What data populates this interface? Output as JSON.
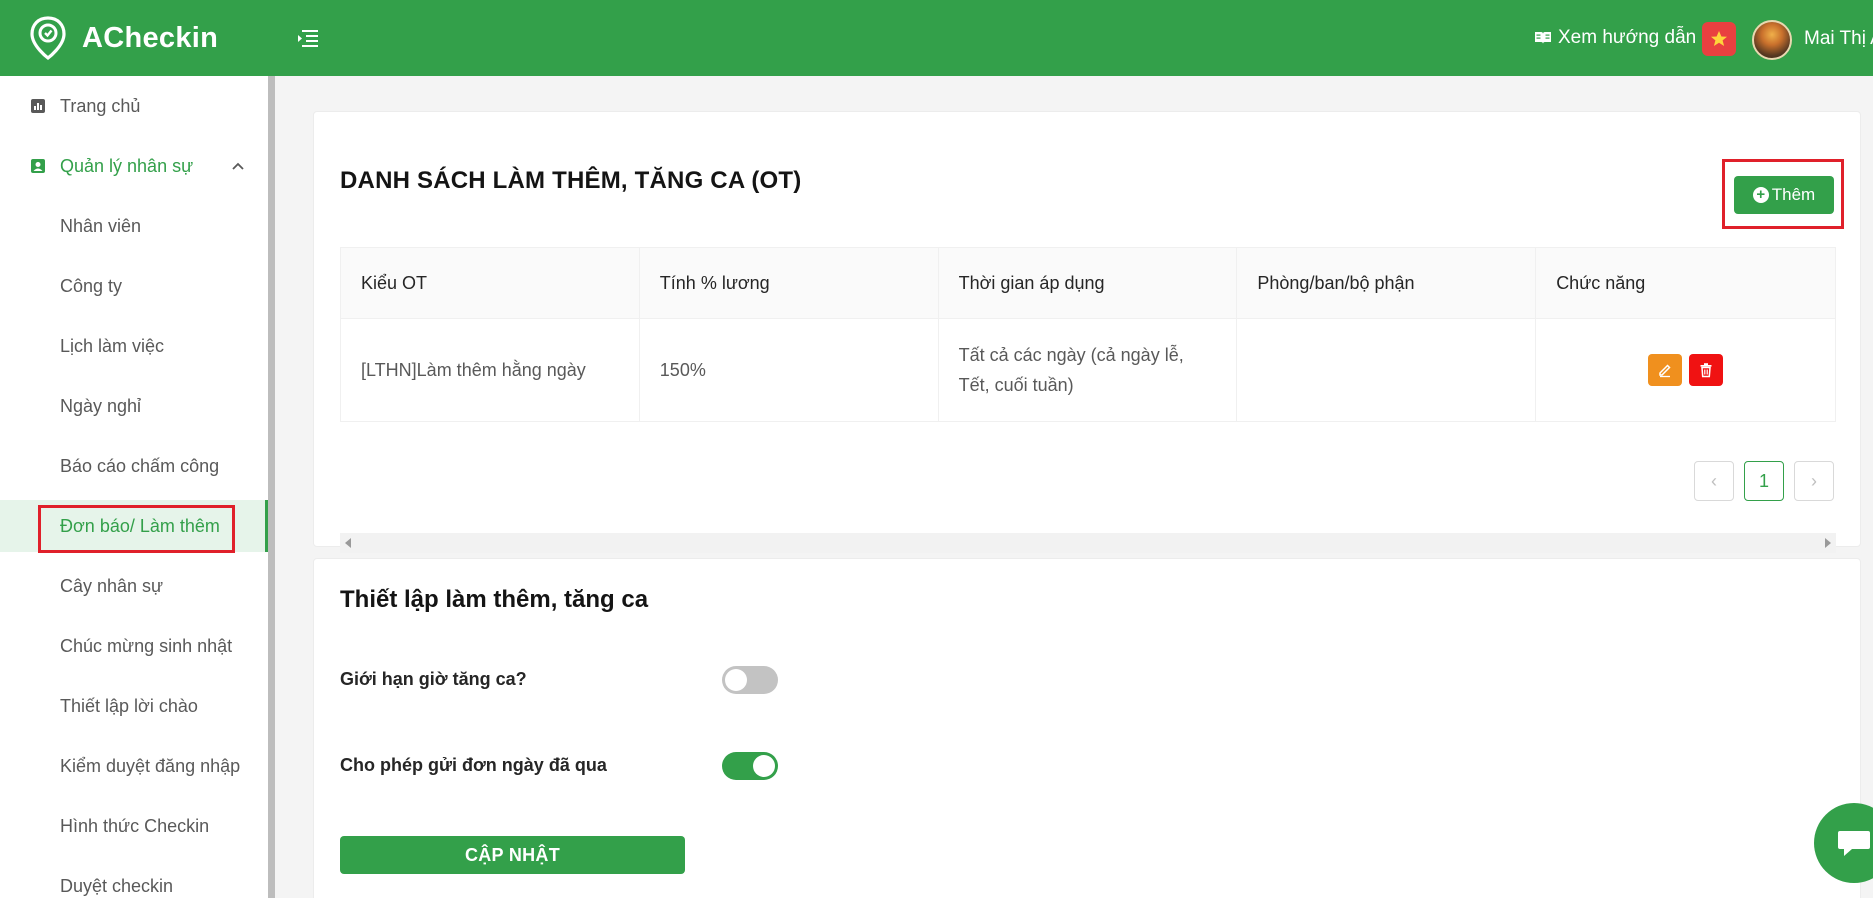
{
  "header": {
    "app_name": "ACheckin",
    "guide_label": "Xem hướng dẫn",
    "user_name": "Mai Thị A"
  },
  "sidebar": {
    "items": [
      {
        "label": "Trang chủ"
      },
      {
        "label": "Quản lý nhân sự"
      },
      {
        "label": "Nhân viên"
      },
      {
        "label": "Công ty"
      },
      {
        "label": "Lịch làm việc"
      },
      {
        "label": "Ngày nghỉ"
      },
      {
        "label": "Báo cáo chấm công"
      },
      {
        "label": "Đơn báo/ Làm thêm"
      },
      {
        "label": "Cây nhân sự"
      },
      {
        "label": "Chúc mừng sinh nhật"
      },
      {
        "label": "Thiết lập lời chào"
      },
      {
        "label": "Kiểm duyệt đăng nhập"
      },
      {
        "label": "Hình thức Checkin"
      },
      {
        "label": "Duyệt checkin"
      }
    ]
  },
  "ot_list": {
    "title": "DANH SÁCH LÀM THÊM, TĂNG CA (OT)",
    "add_label": "Thêm",
    "columns": [
      "Kiểu OT",
      "Tính % lương",
      "Thời gian áp dụng",
      "Phòng/ban/bộ phận",
      "Chức năng"
    ],
    "rows": [
      {
        "type": "[LTHN]Làm thêm hằng ngày",
        "salary": "150%",
        "time": "Tất cả các ngày (cả ngày lễ, Tết, cuối tuần)",
        "department": ""
      }
    ],
    "pagination": {
      "current": "1",
      "prev": "‹",
      "next": "›"
    }
  },
  "ot_settings": {
    "title": "Thiết lập làm thêm, tăng ca",
    "limit_label": "Giới hạn giờ tăng ca?",
    "limit_on": false,
    "past_label": "Cho phép gửi đơn ngày đã qua",
    "past_on": true,
    "update_label": "CẬP NHẬT"
  },
  "colors": {
    "brand": "#33a04a",
    "edit": "#f0901e",
    "delete": "#f01212",
    "highlight": "#e0202a"
  }
}
